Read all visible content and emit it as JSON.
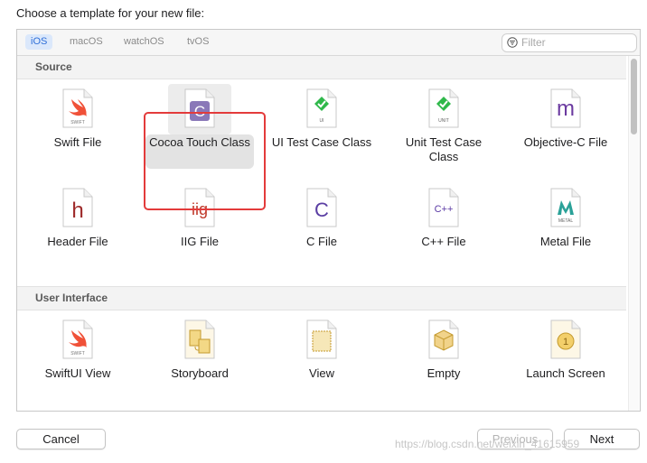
{
  "title": "Choose a template for your new file:",
  "platform_tabs": [
    {
      "label": "iOS",
      "active": true
    },
    {
      "label": "macOS",
      "active": false
    },
    {
      "label": "watchOS",
      "active": false
    },
    {
      "label": "tvOS",
      "active": false
    }
  ],
  "filter": {
    "placeholder": "Filter",
    "value": ""
  },
  "sections": [
    {
      "name": "Source",
      "templates": [
        {
          "label": "Swift File",
          "icon": "swift-file-icon"
        },
        {
          "label": "Cocoa Touch Class",
          "icon": "cocoa-touch-class-icon",
          "selected": true
        },
        {
          "label": "UI Test Case Class",
          "icon": "ui-test-case-icon",
          "badge": "UI"
        },
        {
          "label": "Unit Test Case Class",
          "icon": "unit-test-case-icon",
          "badge": "UNIT"
        },
        {
          "label": "Objective-C File",
          "icon": "objective-c-file-icon",
          "glyph": "m"
        },
        {
          "label": "Header File",
          "icon": "header-file-icon",
          "glyph": "h"
        },
        {
          "label": "IIG File",
          "icon": "iig-file-icon",
          "glyph": "iig"
        },
        {
          "label": "C File",
          "icon": "c-file-icon",
          "glyph": "C"
        },
        {
          "label": "C++ File",
          "icon": "cpp-file-icon",
          "glyph": "C++"
        },
        {
          "label": "Metal File",
          "icon": "metal-file-icon",
          "badge": "METAL"
        }
      ]
    },
    {
      "name": "User Interface",
      "templates": [
        {
          "label": "SwiftUI View",
          "icon": "swiftui-view-icon"
        },
        {
          "label": "Storyboard",
          "icon": "storyboard-icon"
        },
        {
          "label": "View",
          "icon": "view-icon"
        },
        {
          "label": "Empty",
          "icon": "empty-icon"
        },
        {
          "label": "Launch Screen",
          "icon": "launch-screen-icon"
        }
      ]
    }
  ],
  "buttons": {
    "cancel": "Cancel",
    "previous": "Previous",
    "next": "Next"
  },
  "watermark": "https://blog.csdn.net/weixin_41615959",
  "colors": {
    "accent": "#2f6fd8",
    "selection_outline": "#e33b3b",
    "swift": "#f05138",
    "test_green": "#2fb84a",
    "objc_purple": "#6b3aa0",
    "header_red": "#9e2b2b",
    "iig_red": "#c0392b",
    "c_purple": "#5a3ea3",
    "cpp_purple": "#5b3aa5",
    "metal_teal": "#2aa198"
  }
}
